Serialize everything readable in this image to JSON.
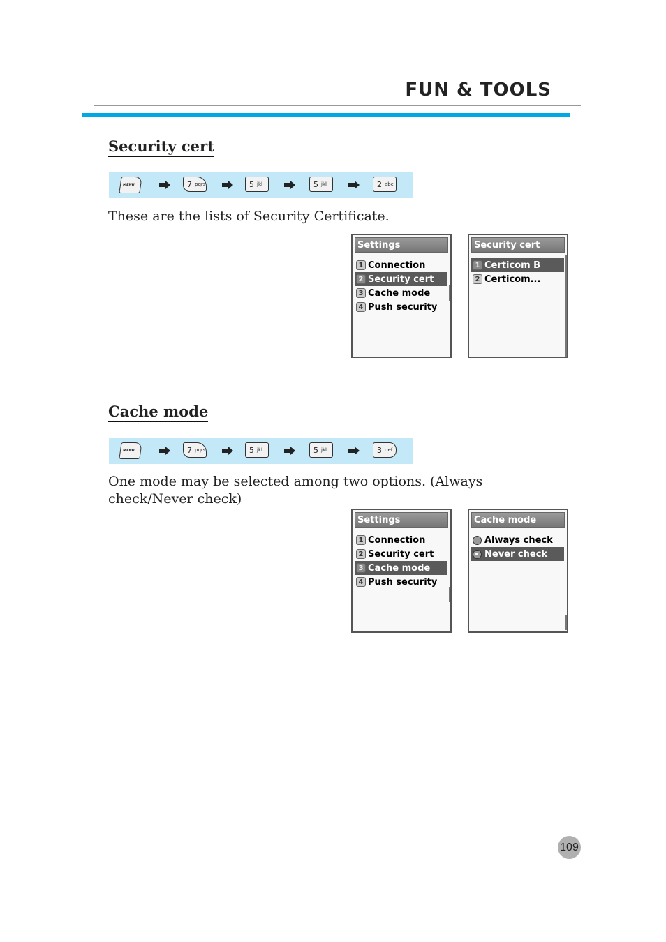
{
  "header": {
    "title": "FUN & TOOLS",
    "accent_color": "#00a8e6"
  },
  "sections": [
    {
      "title": "Security cert",
      "keys": [
        {
          "label": "MENU",
          "sub": ""
        },
        {
          "label": "7",
          "sub": "pqrs"
        },
        {
          "label": "5",
          "sub": "jkl"
        },
        {
          "label": "5",
          "sub": "jkl"
        },
        {
          "label": "2",
          "sub": "abc"
        }
      ],
      "description": "These are the lists of Security Certificate.",
      "screens": [
        {
          "title": "Settings",
          "items": [
            {
              "num": "1",
              "label": "Connection",
              "selected": false
            },
            {
              "num": "2",
              "label": "Security cert",
              "selected": true
            },
            {
              "num": "3",
              "label": "Cache mode",
              "selected": false
            },
            {
              "num": "4",
              "label": "Push security",
              "selected": false
            }
          ]
        },
        {
          "title": "Security cert",
          "items": [
            {
              "num": "1",
              "label": "Certicom B",
              "selected": true
            },
            {
              "num": "2",
              "label": "Certicom...",
              "selected": false
            }
          ]
        }
      ]
    },
    {
      "title": "Cache mode",
      "keys": [
        {
          "label": "MENU",
          "sub": ""
        },
        {
          "label": "7",
          "sub": "pqrs"
        },
        {
          "label": "5",
          "sub": "jkl"
        },
        {
          "label": "5",
          "sub": "jkl"
        },
        {
          "label": "3",
          "sub": "def"
        }
      ],
      "description_line1": "One mode may be selected among two options. (Always",
      "description_line2": "check/Never check)",
      "screens": [
        {
          "title": "Settings",
          "items": [
            {
              "num": "1",
              "label": "Connection",
              "selected": false
            },
            {
              "num": "2",
              "label": "Security cert",
              "selected": false
            },
            {
              "num": "3",
              "label": "Cache mode",
              "selected": true
            },
            {
              "num": "4",
              "label": "Push security",
              "selected": false
            }
          ]
        },
        {
          "title": "Cache mode",
          "options": [
            {
              "label": "Always check",
              "checked": false,
              "selected": false
            },
            {
              "label": "Never check",
              "checked": true,
              "selected": true
            }
          ]
        }
      ]
    }
  ],
  "page_number": "109"
}
